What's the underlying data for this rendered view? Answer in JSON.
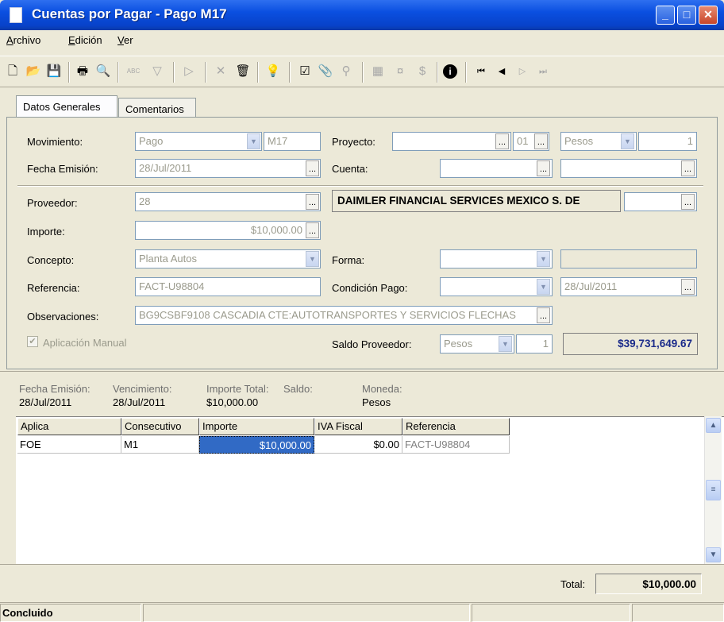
{
  "window": {
    "title": "Cuentas por Pagar - Pago M17"
  },
  "menu": [
    "Archivo",
    "Edición",
    "Ver"
  ],
  "tabs": [
    {
      "label": "Datos Generales",
      "active": true
    },
    {
      "label": "Comentarios",
      "active": false
    }
  ],
  "form": {
    "movimiento": {
      "label": "Movimiento:",
      "value": "Pago",
      "number": "M17"
    },
    "proyecto": {
      "label": "Proyecto:",
      "value": "",
      "code": "01",
      "moneda": "Pesos",
      "tipo_cambio": "1"
    },
    "fecha_emision": {
      "label": "Fecha Emisión:",
      "value": "28/Jul/2011"
    },
    "cuenta": {
      "label": "Cuenta:",
      "value": ""
    },
    "proveedor": {
      "label": "Proveedor:",
      "value": "28",
      "nombre": "DAIMLER FINANCIAL SERVICES MEXICO S. DE"
    },
    "importe": {
      "label": "Importe:",
      "value": "$10,000.00"
    },
    "concepto": {
      "label": "Concepto:",
      "value": "Planta Autos"
    },
    "forma": {
      "label": "Forma:",
      "value": ""
    },
    "referencia": {
      "label": "Referencia:",
      "value": "FACT-U98804"
    },
    "condicion_pago": {
      "label": "Condición Pago:",
      "value": "",
      "fecha": "28/Jul/2011"
    },
    "observaciones": {
      "label": "Observaciones:",
      "value": "BG9CSBF9108 CASCADIA CTE:AUTOTRANSPORTES Y SERVICIOS FLECHAS"
    },
    "aplicacion_manual": {
      "label": "Aplicación Manual",
      "checked": true
    },
    "saldo_proveedor": {
      "label": "Saldo Proveedor:",
      "moneda": "Pesos",
      "tipo_cambio": "1",
      "saldo": "$39,731,649.67"
    }
  },
  "detail_header": {
    "labels": {
      "fecha": "Fecha Emisión:",
      "vencimiento": "Vencimiento:",
      "importe_total": "Importe Total:",
      "saldo": "Saldo:",
      "moneda": "Moneda:"
    },
    "values": {
      "fecha": "28/Jul/2011",
      "vencimiento": "28/Jul/2011",
      "importe_total": "$10,000.00",
      "moneda": "Pesos"
    }
  },
  "grid": {
    "columns": [
      "Aplica",
      "Consecutivo",
      "Importe",
      "IVA Fiscal",
      "Referencia"
    ],
    "rows": [
      [
        "FOE",
        "M1",
        "$10,000.00",
        "$0.00",
        "FACT-U98804"
      ]
    ]
  },
  "footer": {
    "total_label": "Total:",
    "total_value": "$10,000.00"
  },
  "status": {
    "text": "Concluido"
  }
}
